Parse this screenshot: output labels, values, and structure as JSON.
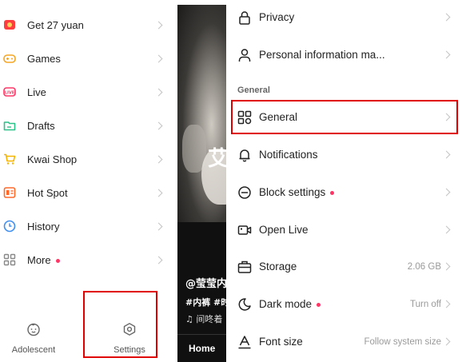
{
  "left_menu": {
    "items": [
      {
        "label": "Get 27 yuan",
        "icon": "red-envelope-icon",
        "dot": false
      },
      {
        "label": "Games",
        "icon": "gamepad-icon",
        "dot": false
      },
      {
        "label": "Live",
        "icon": "live-icon",
        "dot": false
      },
      {
        "label": "Drafts",
        "icon": "drafts-folder-icon",
        "dot": false
      },
      {
        "label": "Kwai Shop",
        "icon": "shopping-cart-icon",
        "dot": false
      },
      {
        "label": "Hot Spot",
        "icon": "hot-spot-icon",
        "dot": false
      },
      {
        "label": "History",
        "icon": "clock-icon",
        "dot": false
      },
      {
        "label": "More",
        "icon": "grid-icon",
        "dot": true
      }
    ],
    "bottom": {
      "adolescent_label": "Adolescent",
      "settings_label": "Settings"
    }
  },
  "video": {
    "big_char": "艾",
    "author": "@莹莹内",
    "tags": "#内裤 #时",
    "music": "♫ 间咚着",
    "home_tab": "Home"
  },
  "settings": {
    "items_top": [
      {
        "label": "Privacy",
        "icon": "lock-icon"
      },
      {
        "label": "Personal information ma...",
        "icon": "person-icon"
      }
    ],
    "section_title": "General",
    "items": [
      {
        "label": "General",
        "icon": "general-grid-icon",
        "value": "",
        "dot": false
      },
      {
        "label": "Notifications",
        "icon": "bell-icon",
        "value": "",
        "dot": false
      },
      {
        "label": "Block settings",
        "icon": "block-icon",
        "value": "",
        "dot": true
      },
      {
        "label": "Open Live",
        "icon": "open-live-icon",
        "value": "",
        "dot": false
      },
      {
        "label": "Storage",
        "icon": "storage-icon",
        "value": "2.06 GB",
        "dot": false
      },
      {
        "label": "Dark mode",
        "icon": "moon-icon",
        "value": "Turn off",
        "dot": true
      },
      {
        "label": "Font size",
        "icon": "font-size-icon",
        "value": "Follow system size",
        "dot": false
      }
    ]
  },
  "colors": {
    "accent_red": "#fe3666",
    "highlight_box": "#e00000",
    "icon_orange": "#f5a623",
    "icon_pink": "#fe3666",
    "icon_green": "#2cc28a",
    "icon_yellow": "#f7b500",
    "icon_blue": "#3f8ff0"
  }
}
